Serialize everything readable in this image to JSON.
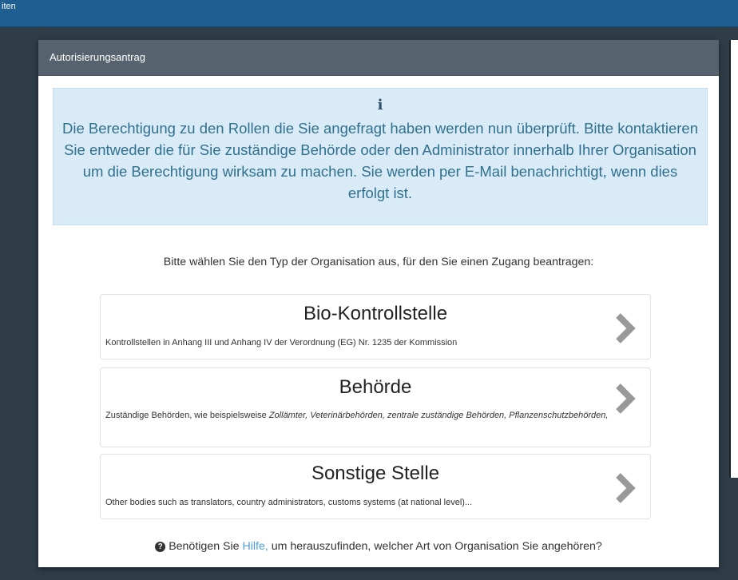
{
  "topbar": {
    "text": "iten"
  },
  "modal": {
    "title": "Autorisierungsantrag",
    "alert": {
      "icon": "info-icon",
      "text": "Die Berechtigung zu den Rollen die Sie angefragt haben werden nun überprüft. Bitte kontaktieren Sie entweder die für Sie zuständige Behörde oder den Administrator innerhalb Ihrer Organisation um die Berechtigung wirksam zu machen. Sie werden per E-Mail benachrichtigt, wenn dies erfolgt ist."
    },
    "prompt": "Bitte wählen Sie den Typ der Organisation aus, für den Sie einen Zugang beantragen:",
    "options": [
      {
        "title": "Bio-Kontrollstelle",
        "description": "Kontrollstellen in Anhang III und Anhang IV der Verordnung (EG) Nr. 1235 der Kommission"
      },
      {
        "title": "Behörde",
        "description_prefix": "Zuständige Behörden, wie beispielsweise ",
        "description_italic": "Zollämter, Veterinärbehörden, zentrale zuständige Behörden, Pflanzenschutzbehörden,"
      },
      {
        "title": "Sonstige Stelle",
        "description": "Other bodies such as translators, country administrators, customs systems (at national level)..."
      }
    ],
    "help": {
      "icon": "question-circle-icon",
      "before": "Benötigen Sie ",
      "link": "Hilfe,",
      "after": " um herauszufinden, welcher Art von Organisation Sie angehören?"
    }
  },
  "colors": {
    "topbar": "#1f5e91",
    "alert_bg": "#d8ebf6",
    "alert_text": "#31708f",
    "link": "#4a9fd8",
    "chevron": "#999999"
  }
}
